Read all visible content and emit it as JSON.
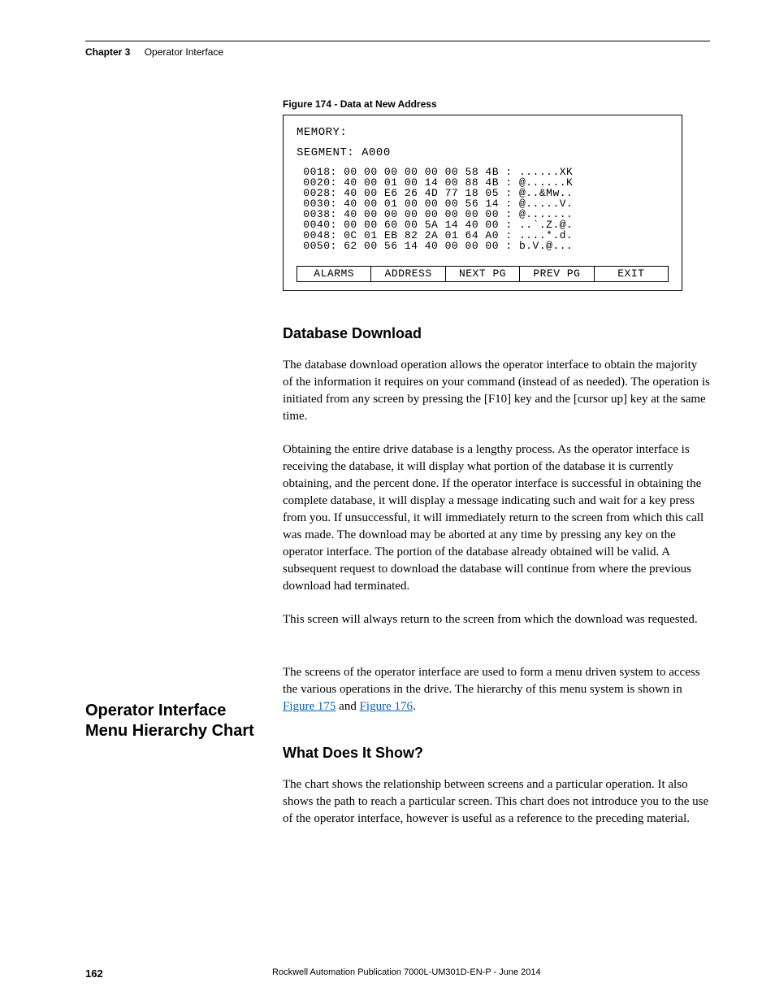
{
  "header": {
    "chapter_label": "Chapter 3",
    "chapter_title": "Operator Interface"
  },
  "figure": {
    "caption": "Figure 174 - Data at New Address",
    "screen": {
      "line_memory": "MEMORY:",
      "line_segment": "SEGMENT: A000",
      "dump": " 0018: 00 00 00 00 00 00 58 4B : ......XK\n 0020: 40 00 01 00 14 00 88 4B : @......K\n 0028: 40 00 E6 26 4D 77 18 05 : @..&Mw..\n 0030: 40 00 01 00 00 00 56 14 : @.....V.\n 0038: 40 00 00 00 00 00 00 00 : @.......\n 0040: 00 00 60 00 5A 14 40 00 : ..`.Z.@.\n 0048: 0C 01 EB 82 2A 01 64 A0 : ....*.d.\n 0050: 62 00 56 14 40 00 00 00 : b.V.@...",
      "buttons": {
        "b1": "ALARMS",
        "b2": "ADDRESS",
        "b3": "NEXT PG",
        "b4": "PREV PG",
        "b5": "EXIT"
      }
    }
  },
  "section_db": {
    "heading": "Database Download",
    "p1": "The database download operation allows the operator interface to obtain the majority of the information it requires on your command (instead of as needed). The operation is initiated from any screen by pressing the [F10] key and the [cursor up] key at the same time.",
    "p2": "Obtaining the entire drive database is a lengthy process. As the operator interface is receiving the database, it will display what portion of the database it is currently obtaining, and the percent done. If the operator interface is successful in obtaining the complete database, it will display a message indicating such and wait for a key press from you. If unsuccessful, it will immediately return to the screen from which this call was made. The download may be aborted at any time by pressing any key on the operator interface. The portion of the database already obtained will be valid. A subsequent request to download the database will continue from where the previous download had terminated.",
    "p3": "This screen will always return to the screen from which the download was requested."
  },
  "section_menu": {
    "side_heading": "Operator Interface Menu Hierarchy Chart",
    "p1_a": "The screens of the operator interface are used to form a menu driven system to access the various operations in the drive. The hierarchy of this menu system is shown in ",
    "p1_link1": "Figure 175",
    "p1_mid": " and ",
    "p1_link2": "Figure 176",
    "p1_end": ".",
    "sub_heading": "What Does It Show?",
    "p2": "The chart shows the relationship between screens and a particular operation. It also shows the path to reach a particular screen. This chart does not introduce you to the use of the operator interface, however is useful as a reference to the preceding material."
  },
  "footer": {
    "page_number": "162",
    "publication": "Rockwell Automation Publication 7000L-UM301D-EN-P - June 2014"
  }
}
